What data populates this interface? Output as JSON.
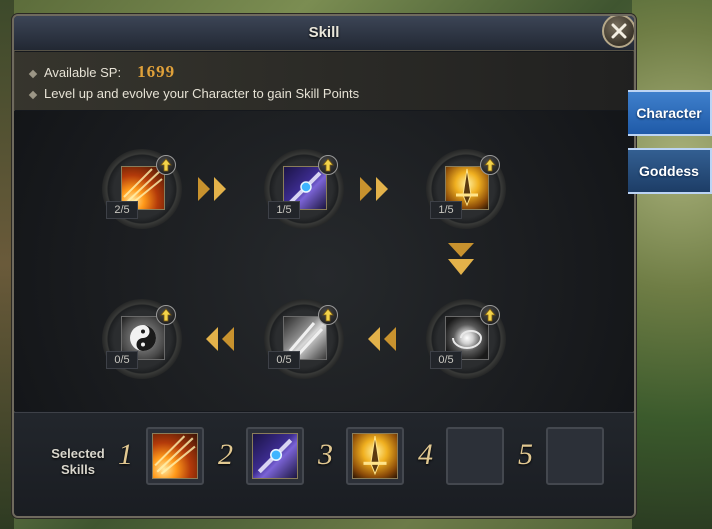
{
  "window": {
    "title": "Skill"
  },
  "info": {
    "sp_label": "Available SP:",
    "sp_value": "1699",
    "hint": "Level up and evolve your Character to gain Skill Points"
  },
  "skills": [
    {
      "level": "2/5",
      "icon": "flame-streak-icon"
    },
    {
      "level": "1/5",
      "icon": "spear-orb-icon"
    },
    {
      "level": "1/5",
      "icon": "golden-sword-icon"
    },
    {
      "level": "0/5",
      "icon": "vortex-icon"
    },
    {
      "level": "0/5",
      "icon": "blade-slash-icon"
    },
    {
      "level": "0/5",
      "icon": "yin-yang-icon"
    }
  ],
  "selected": {
    "label": "Selected Skills",
    "slots": [
      {
        "number": "1",
        "icon": "flame-streak-icon"
      },
      {
        "number": "2",
        "icon": "spear-orb-icon"
      },
      {
        "number": "3",
        "icon": "golden-sword-icon"
      },
      {
        "number": "4",
        "icon": ""
      },
      {
        "number": "5",
        "icon": ""
      }
    ]
  },
  "side_tabs": [
    {
      "label": "Character"
    },
    {
      "label": "Goddess"
    }
  ]
}
